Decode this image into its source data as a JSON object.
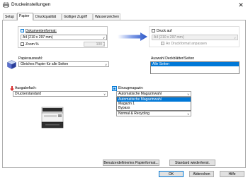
{
  "window": {
    "title": "Druckeinstellungen",
    "close_glyph": "✕"
  },
  "tabs": [
    {
      "label": "Setup",
      "active": false
    },
    {
      "label": "Papier",
      "active": true
    },
    {
      "label": "Druckqualität",
      "active": false
    },
    {
      "label": "Gültiger Zugriff",
      "active": false
    },
    {
      "label": "Wasserzeichen",
      "active": false
    }
  ],
  "document_format": {
    "label": "Dokumentenformat:",
    "value": "A4 (210 x 297 mm)",
    "zoom_label": "Zoom",
    "zoom_unit": "%",
    "zoom_value": "100"
  },
  "print_on": {
    "label": "Druck auf",
    "value": "A4 (210 x 297 mm)",
    "fit_label": "An Druckformat anpassen"
  },
  "paper_selection": {
    "label": "Papierauswahl:",
    "value": "Gleiches Papier für alle Seiten"
  },
  "cover_pages": {
    "label": "Auswahl Deckblätter/Seiten",
    "items": [
      "Alle Seiten"
    ]
  },
  "output_tray": {
    "label": "Ausgabefach:",
    "value": "Druckerstandard"
  },
  "input_tray": {
    "label": "Einzugmagazin:",
    "value": "Automatische Magazinwahl",
    "options": [
      "Automatische Magazinwahl",
      "Magazin 1",
      "Bypass"
    ],
    "selected_index": 0
  },
  "paper_type_partial": "Normal & Recycling",
  "buttons": {
    "custom_paper": "Benutzerdefiniertes Papierformat...",
    "restore_defaults": "Standard wiederherst.",
    "ok": "OK",
    "cancel": "Abbrechen",
    "help": "Hilfe"
  },
  "colors": {
    "accent": "#0078d7",
    "arrow": "#2a56c6",
    "output_arrow": "#d92b2b"
  }
}
